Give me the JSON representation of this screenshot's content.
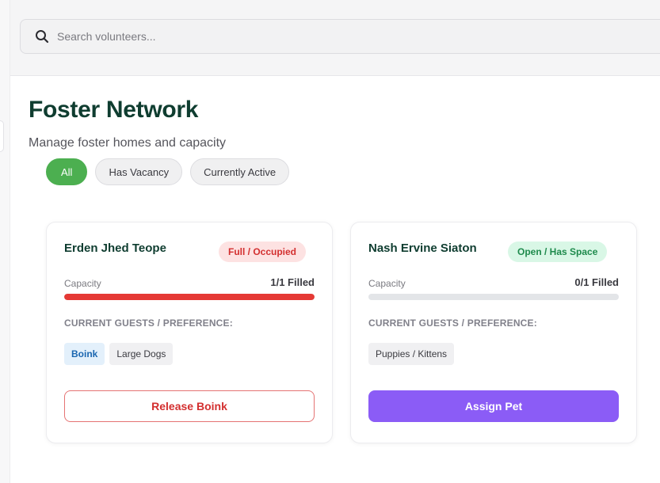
{
  "search": {
    "placeholder": "Search volunteers..."
  },
  "page": {
    "title": "Foster Network",
    "subtitle": "Manage foster homes and capacity"
  },
  "filters": [
    {
      "label": "All",
      "active": true
    },
    {
      "label": "Has Vacancy",
      "active": false
    },
    {
      "label": "Currently Active",
      "active": false
    }
  ],
  "cards": [
    {
      "name": "Erden Jhed Teope",
      "status": "Full / Occupied",
      "capacity_label": "Capacity",
      "capacity_text": "1/1 Filled",
      "fill_fraction": 1.0,
      "guests_label": "CURRENT GUESTS / PREFERENCE:",
      "guest": "Boink",
      "preference": "Large Dogs",
      "action": "Release Boink"
    },
    {
      "name": "Nash Ervine Siaton",
      "status": "Open / Has Space",
      "capacity_label": "Capacity",
      "capacity_text": "0/1 Filled",
      "fill_fraction": 0.0,
      "guests_label": "CURRENT GUESTS / PREFERENCE:",
      "preference": "Puppies / Kittens",
      "action": "Assign Pet"
    }
  ],
  "colors": {
    "accent_green": "#4caf50",
    "title_green": "#0f3d30",
    "full_red": "#e53935",
    "open_green": "#1e8a4c",
    "assign_purple": "#8b5cf6",
    "guest_blue": "#1a66b0"
  },
  "icons": {
    "search": "search-icon"
  }
}
